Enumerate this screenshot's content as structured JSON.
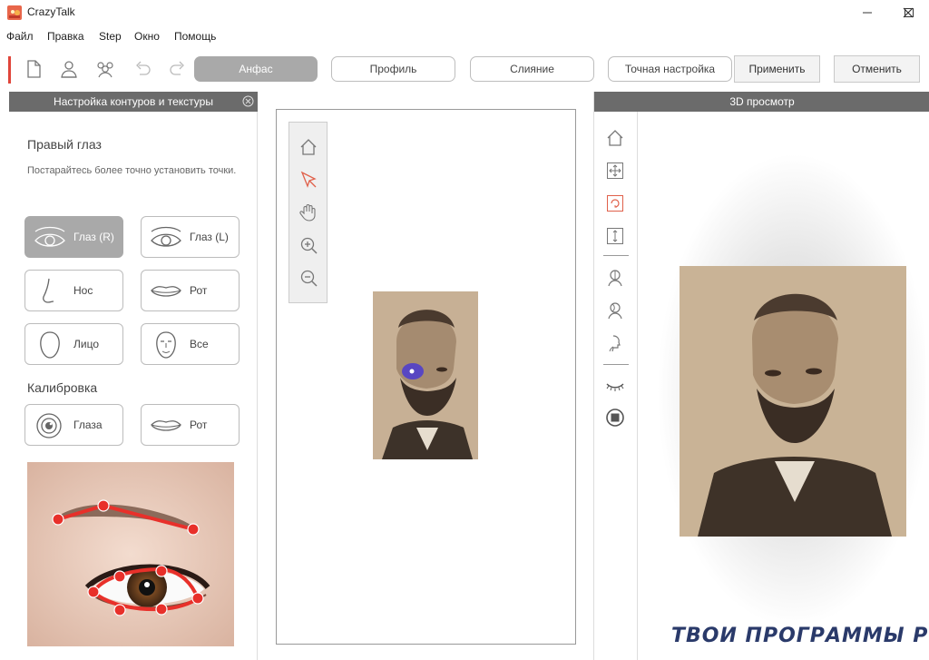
{
  "window": {
    "title": "CrazyTalk"
  },
  "menu": [
    "Файл",
    "Правка",
    "Step",
    "Окно",
    "Помощь"
  ],
  "toolbar": {
    "icons": [
      "new-file-icon",
      "single-profile-icon",
      "group-profile-icon",
      "undo-icon",
      "redo-icon"
    ],
    "tabs": [
      {
        "label": "Анфас",
        "active": true
      },
      {
        "label": "Профиль",
        "active": false
      },
      {
        "label": "Слияние",
        "active": false
      },
      {
        "label": "Точная настройка",
        "active": false
      }
    ],
    "apply_label": "Применить",
    "cancel_label": "Отменить",
    "accent_color": "#e0453a"
  },
  "left_panel": {
    "header": "Настройка контуров и текстуры",
    "section_title": "Правый глаз",
    "hint": "Постарайтесь более точно установить точки.",
    "features": [
      {
        "label": "Глаз (R)",
        "icon": "eye-right-icon",
        "active": true
      },
      {
        "label": "Глаз (L)",
        "icon": "eye-left-icon",
        "active": false
      },
      {
        "label": "Нос",
        "icon": "nose-icon",
        "active": false
      },
      {
        "label": "Рот",
        "icon": "mouth-icon",
        "active": false
      },
      {
        "label": "Лицо",
        "icon": "face-outline-icon",
        "active": false
      },
      {
        "label": "Все",
        "icon": "face-all-icon",
        "active": false
      }
    ],
    "calibration_title": "Калибровка",
    "calibration": [
      {
        "label": "Глаза",
        "icon": "eye-calibration-icon"
      },
      {
        "label": "Рот",
        "icon": "mouth-calibration-icon"
      }
    ]
  },
  "center": {
    "tools": [
      "home-icon",
      "select-arrow-icon",
      "hand-pan-icon",
      "zoom-in-icon",
      "zoom-out-icon"
    ]
  },
  "right_panel": {
    "header": "3D просмотр",
    "tools": [
      "home-icon",
      "move-icon",
      "rotate-icon",
      "vertical-move-icon",
      "face-front-icon",
      "face-angle-icon",
      "face-side-icon",
      "eyelash-icon",
      "reset-icon"
    ]
  },
  "watermark": "ТВОИ ПРОГРАММЫ РУ"
}
